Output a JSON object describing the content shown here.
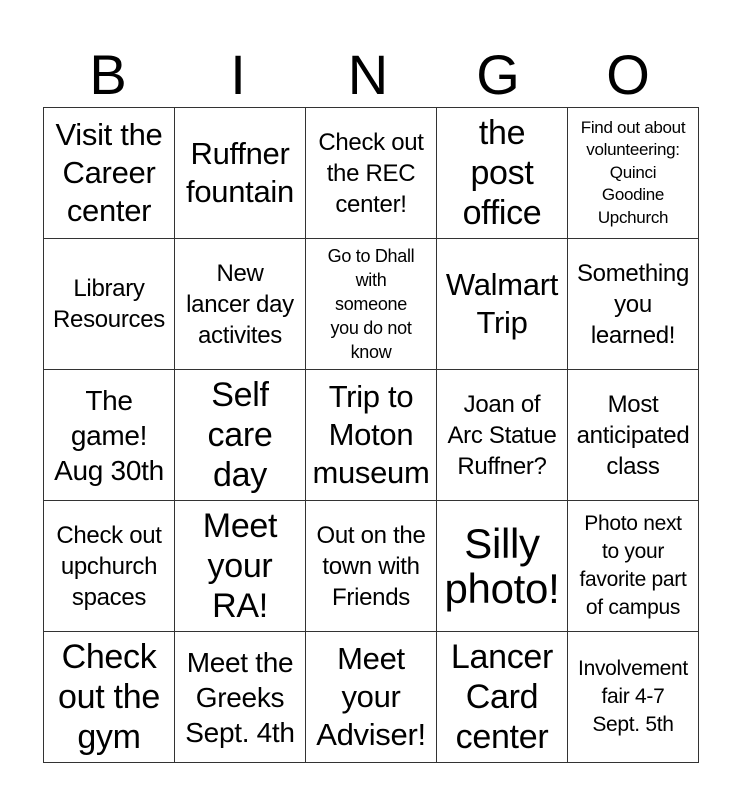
{
  "header": {
    "letters": [
      "B",
      "I",
      "N",
      "G",
      "O"
    ]
  },
  "board": {
    "rows": [
      [
        {
          "text": "Visit the\nCareer\ncenter",
          "size": "fs-ml"
        },
        {
          "text": "Ruffner\nfountain",
          "size": "fs-ml"
        },
        {
          "text": "Check out\nthe REC\ncenter!",
          "size": "fs-s"
        },
        {
          "text": "the\npost\noffice",
          "size": "fs-l"
        },
        {
          "text": "Find out about\nvolunteering:\nQuinci\nGoodine\nUpchurch",
          "size": "fs-tiny"
        }
      ],
      [
        {
          "text": "Library\nResources",
          "size": "fs-s"
        },
        {
          "text": "New\nlancer day\nactivites",
          "size": "fs-s"
        },
        {
          "text": "Go to Dhall\nwith\nsomeone\nyou do not\nknow",
          "size": "fs-xxs"
        },
        {
          "text": "Walmart\nTrip",
          "size": "fs-ml"
        },
        {
          "text": "Something\nyou\nlearned!",
          "size": "fs-s"
        }
      ],
      [
        {
          "text": "The\ngame!\nAug 30th",
          "size": "fs-m"
        },
        {
          "text": "Self\ncare\nday",
          "size": "fs-l"
        },
        {
          "text": "Trip to\nMoton\nmuseum",
          "size": "fs-ml"
        },
        {
          "text": "Joan of\nArc Statue\nRuffner?",
          "size": "fs-s"
        },
        {
          "text": "Most\nanticipated\nclass",
          "size": "fs-s"
        }
      ],
      [
        {
          "text": "Check out\nupchurch\nspaces",
          "size": "fs-s"
        },
        {
          "text": "Meet\nyour\nRA!",
          "size": "fs-l"
        },
        {
          "text": "Out on the\ntown with\nFriends",
          "size": "fs-s"
        },
        {
          "text": "Silly\nphoto!",
          "size": "fs-xl"
        },
        {
          "text": "Photo next\nto your\nfavorite part\nof campus",
          "size": "fs-xs"
        }
      ],
      [
        {
          "text": "Check\nout the\ngym",
          "size": "fs-l"
        },
        {
          "text": "Meet the\nGreeks\nSept. 4th",
          "size": "fs-m"
        },
        {
          "text": "Meet\nyour\nAdviser!",
          "size": "fs-ml"
        },
        {
          "text": "Lancer\nCard\ncenter",
          "size": "fs-l"
        },
        {
          "text": "Involvement\nfair 4-7\nSept. 5th",
          "size": "fs-xs"
        }
      ]
    ]
  }
}
